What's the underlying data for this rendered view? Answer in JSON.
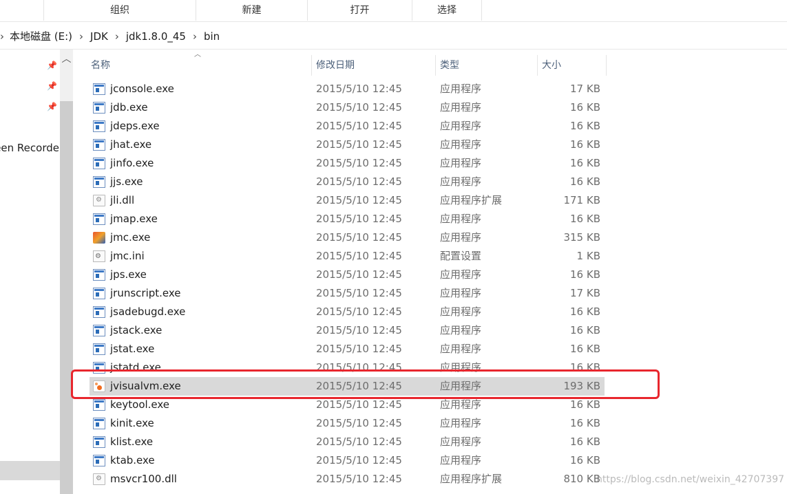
{
  "ribbon": {
    "groups": [
      "组织",
      "新建",
      "打开",
      "选择"
    ]
  },
  "address": {
    "crumbs": [
      "本地磁盘 (E:)",
      "JDK",
      "jdk1.8.0_45",
      "bin"
    ]
  },
  "navpane": {
    "visible_text": "een Recorde"
  },
  "columns": {
    "name": "名称",
    "date": "修改日期",
    "type": "类型",
    "size": "大小"
  },
  "files": [
    {
      "name": "jconsole.exe",
      "date": "2015/5/10 12:45",
      "type": "应用程序",
      "size": "17 KB",
      "icon": "exe-icon"
    },
    {
      "name": "jdb.exe",
      "date": "2015/5/10 12:45",
      "type": "应用程序",
      "size": "16 KB",
      "icon": "exe-icon"
    },
    {
      "name": "jdeps.exe",
      "date": "2015/5/10 12:45",
      "type": "应用程序",
      "size": "16 KB",
      "icon": "exe-icon"
    },
    {
      "name": "jhat.exe",
      "date": "2015/5/10 12:45",
      "type": "应用程序",
      "size": "16 KB",
      "icon": "exe-icon"
    },
    {
      "name": "jinfo.exe",
      "date": "2015/5/10 12:45",
      "type": "应用程序",
      "size": "16 KB",
      "icon": "exe-icon"
    },
    {
      "name": "jjs.exe",
      "date": "2015/5/10 12:45",
      "type": "应用程序",
      "size": "16 KB",
      "icon": "exe-icon"
    },
    {
      "name": "jli.dll",
      "date": "2015/5/10 12:45",
      "type": "应用程序扩展",
      "size": "171 KB",
      "icon": "dll-icon"
    },
    {
      "name": "jmap.exe",
      "date": "2015/5/10 12:45",
      "type": "应用程序",
      "size": "16 KB",
      "icon": "exe-icon"
    },
    {
      "name": "jmc.exe",
      "date": "2015/5/10 12:45",
      "type": "应用程序",
      "size": "315 KB",
      "icon": "jmc-icon"
    },
    {
      "name": "jmc.ini",
      "date": "2015/5/10 12:45",
      "type": "配置设置",
      "size": "1 KB",
      "icon": "ini-icon"
    },
    {
      "name": "jps.exe",
      "date": "2015/5/10 12:45",
      "type": "应用程序",
      "size": "16 KB",
      "icon": "exe-icon"
    },
    {
      "name": "jrunscript.exe",
      "date": "2015/5/10 12:45",
      "type": "应用程序",
      "size": "17 KB",
      "icon": "exe-icon"
    },
    {
      "name": "jsadebugd.exe",
      "date": "2015/5/10 12:45",
      "type": "应用程序",
      "size": "16 KB",
      "icon": "exe-icon"
    },
    {
      "name": "jstack.exe",
      "date": "2015/5/10 12:45",
      "type": "应用程序",
      "size": "16 KB",
      "icon": "exe-icon"
    },
    {
      "name": "jstat.exe",
      "date": "2015/5/10 12:45",
      "type": "应用程序",
      "size": "16 KB",
      "icon": "exe-icon"
    },
    {
      "name": "jstatd.exe",
      "date": "2015/5/10 12:45",
      "type": "应用程序",
      "size": "16 KB",
      "icon": "exe-icon"
    },
    {
      "name": "jvisualvm.exe",
      "date": "2015/5/10 12:45",
      "type": "应用程序",
      "size": "193 KB",
      "icon": "jvisualvm-icon",
      "selected": true
    },
    {
      "name": "keytool.exe",
      "date": "2015/5/10 12:45",
      "type": "应用程序",
      "size": "16 KB",
      "icon": "exe-icon"
    },
    {
      "name": "kinit.exe",
      "date": "2015/5/10 12:45",
      "type": "应用程序",
      "size": "16 KB",
      "icon": "exe-icon"
    },
    {
      "name": "klist.exe",
      "date": "2015/5/10 12:45",
      "type": "应用程序",
      "size": "16 KB",
      "icon": "exe-icon"
    },
    {
      "name": "ktab.exe",
      "date": "2015/5/10 12:45",
      "type": "应用程序",
      "size": "16 KB",
      "icon": "exe-icon"
    },
    {
      "name": "msvcr100.dll",
      "date": "2015/5/10 12:45",
      "type": "应用程序扩展",
      "size": "810 KB",
      "icon": "dll-icon"
    }
  ],
  "watermark": "https://blog.csdn.net/weixin_42707397",
  "colors": {
    "highlight": "#e8262d",
    "selected_row": "#d9d9d9",
    "header_text": "#4c607a"
  }
}
